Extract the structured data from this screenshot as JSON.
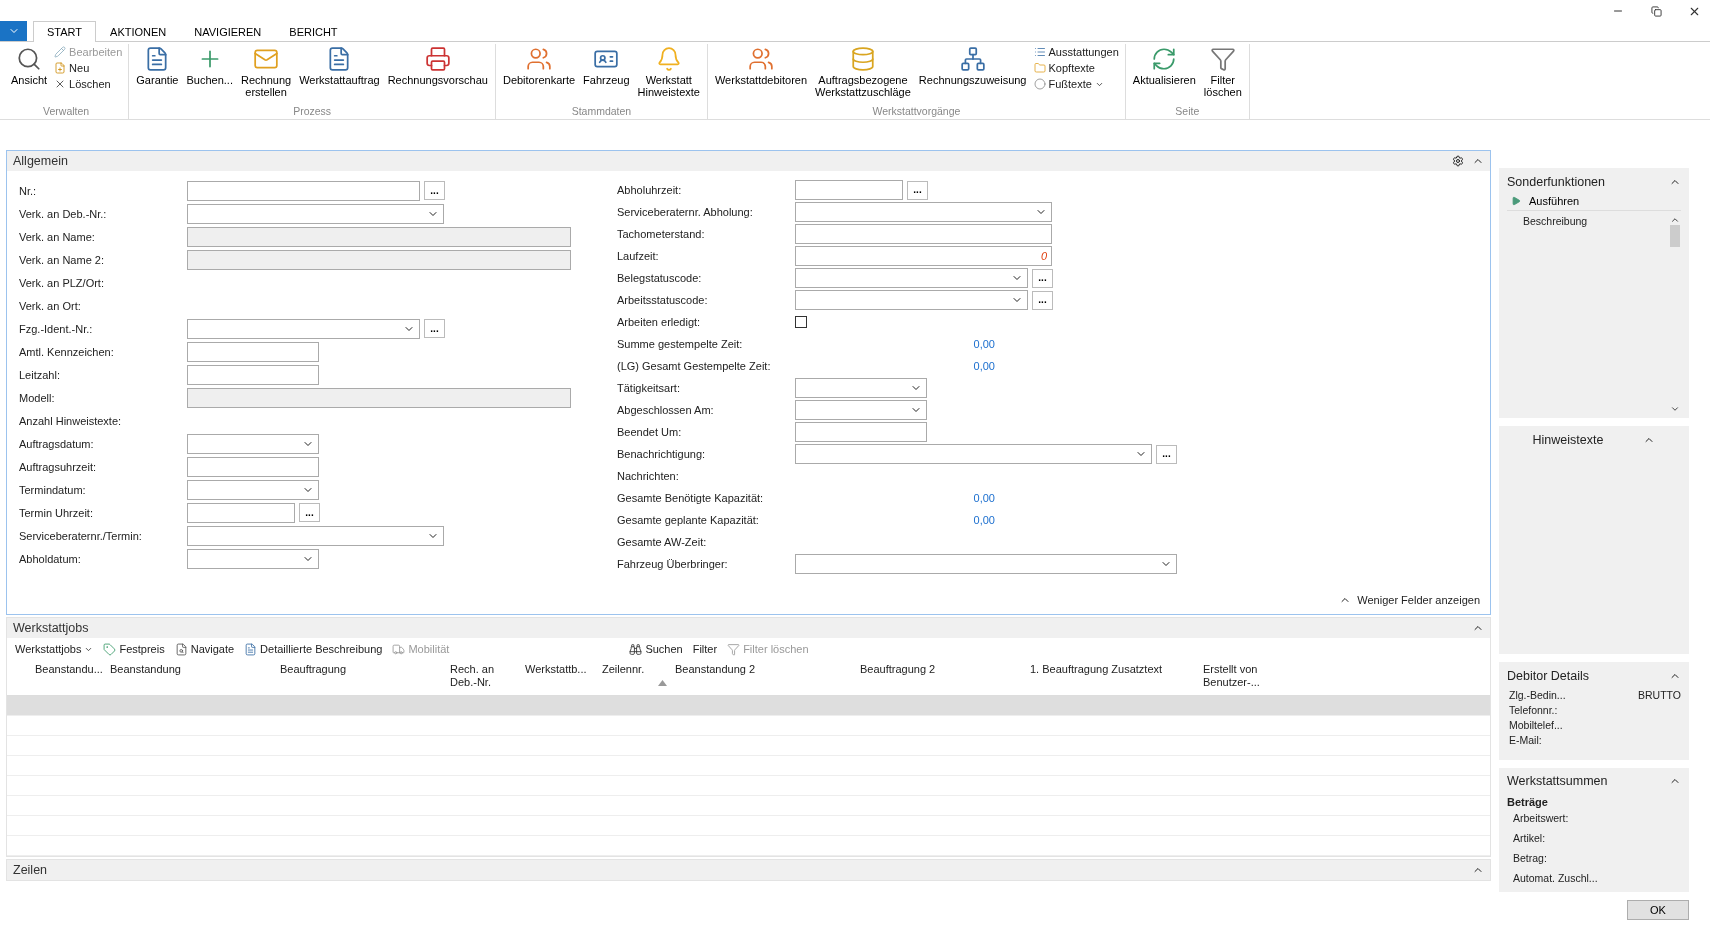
{
  "tabs": [
    {
      "label": "START",
      "selected": true
    },
    {
      "label": "AKTIONEN",
      "selected": false
    },
    {
      "label": "NAVIGIEREN",
      "selected": false
    },
    {
      "label": "BERICHT",
      "selected": false
    }
  ],
  "ribbon": [
    {
      "title": "Verwalten",
      "items": [
        {
          "kind": "large",
          "label": "Ansicht"
        },
        {
          "kind": "small-stack",
          "items": [
            {
              "label": "Bearbeiten",
              "disabled": true
            },
            {
              "label": "Neu",
              "disabled": false
            },
            {
              "label": "Löschen",
              "disabled": false
            }
          ]
        }
      ]
    },
    {
      "title": "Prozess",
      "items": [
        {
          "kind": "large",
          "label": "Garantie"
        },
        {
          "kind": "large",
          "label": "Buchen..."
        },
        {
          "kind": "large",
          "label": "Rechnung\nerstellen"
        },
        {
          "kind": "large",
          "label": "Werkstattauftrag"
        },
        {
          "kind": "large",
          "label": "Rechnungsvorschau"
        }
      ]
    },
    {
      "title": "Stammdaten",
      "items": [
        {
          "kind": "large",
          "label": "Debitorenkarte"
        },
        {
          "kind": "large",
          "label": "Fahrzeug"
        },
        {
          "kind": "large",
          "label": "Werkstatt\nHinweistexte"
        }
      ]
    },
    {
      "title": "Werkstattvorgänge",
      "items": [
        {
          "kind": "large",
          "label": "Werkstattdebitoren"
        },
        {
          "kind": "large",
          "label": "Auftragsbezogene\nWerkstattzuschläge"
        },
        {
          "kind": "large",
          "label": "Rechnungszuweisung"
        },
        {
          "kind": "small-stack",
          "items": [
            {
              "label": "Ausstattungen",
              "disabled": false
            },
            {
              "label": "Kopftexte",
              "disabled": false
            },
            {
              "label": "Fußtexte",
              "disabled": false,
              "caret": true
            }
          ]
        }
      ]
    },
    {
      "title": "Seite",
      "items": [
        {
          "kind": "large",
          "label": "Aktualisieren"
        },
        {
          "kind": "large",
          "label": "Filter\nlöschen"
        }
      ]
    }
  ],
  "general": {
    "title": "Allgemein",
    "expanded": true,
    "more_link": "Weniger Felder anzeigen",
    "left": [
      {
        "label": "Nr.:",
        "kind": "text",
        "lookup_button": "..."
      },
      {
        "label": "Verk. an Deb.-Nr.:",
        "kind": "dropdown"
      },
      {
        "label": "Verk. an Name:",
        "kind": "readonly"
      },
      {
        "label": "Verk. an Name 2:",
        "kind": "readonly"
      },
      {
        "label": "Verk. an PLZ/Ort:",
        "kind": "none"
      },
      {
        "label": "Verk. an Ort:",
        "kind": "none"
      },
      {
        "label": "Fzg.-Ident.-Nr.:",
        "kind": "dropdown",
        "lookup_button": "..."
      },
      {
        "label": "Amtl. Kennzeichen:",
        "kind": "text"
      },
      {
        "label": "Leitzahl:",
        "kind": "text"
      },
      {
        "label": "Modell:",
        "kind": "readonly"
      },
      {
        "label": "Anzahl Hinweistexte:",
        "kind": "none"
      },
      {
        "label": "Auftragsdatum:",
        "kind": "dropdown"
      },
      {
        "label": "Auftragsuhrzeit:",
        "kind": "text"
      },
      {
        "label": "Termindatum:",
        "kind": "dropdown"
      },
      {
        "label": "Termin Uhrzeit:",
        "kind": "text",
        "lookup_button": "..."
      },
      {
        "label": "Serviceberaternr./Termin:",
        "kind": "dropdown"
      },
      {
        "label": "Abholdatum:",
        "kind": "dropdown"
      }
    ],
    "right": [
      {
        "label": "Abholuhrzeit:",
        "kind": "text",
        "lookup_button": "..."
      },
      {
        "label": "Serviceberaternr. Abholung:",
        "kind": "dropdown"
      },
      {
        "label": "Tachometerstand:",
        "kind": "text"
      },
      {
        "label": "Laufzeit:",
        "kind": "text",
        "value": "0"
      },
      {
        "label": "Belegstatuscode:",
        "kind": "dropdown",
        "lookup_button": "..."
      },
      {
        "label": "Arbeitsstatuscode:",
        "kind": "dropdown",
        "lookup_button": "..."
      },
      {
        "label": "Arbeiten erledigt:",
        "kind": "checkbox",
        "checked": false
      },
      {
        "label": "Summe gestempelte Zeit:",
        "kind": "value",
        "value": "0,00"
      },
      {
        "label": "(LG) Gesamt Gestempelte Zeit:",
        "kind": "value",
        "value": "0,00"
      },
      {
        "label": "Tätigkeitsart:",
        "kind": "dropdown"
      },
      {
        "label": "Abgeschlossen Am:",
        "kind": "dropdown"
      },
      {
        "label": "Beendet Um:",
        "kind": "text"
      },
      {
        "label": "Benachrichtigung:",
        "kind": "dropdown",
        "lookup_button": "..."
      },
      {
        "label": "Nachrichten:",
        "kind": "none"
      },
      {
        "label": "Gesamte Benötigte Kapazität:",
        "kind": "value",
        "value": "0,00"
      },
      {
        "label": "Gesamte geplante Kapazität:",
        "kind": "value",
        "value": "0,00"
      },
      {
        "label": "Gesamte AW-Zeit:",
        "kind": "none"
      },
      {
        "label": "Fahrzeug Überbringer:",
        "kind": "dropdown"
      }
    ]
  },
  "jobs": {
    "title": "Werkstattjobs",
    "toolbar": [
      {
        "kind": "menu",
        "label": "Werkstattjobs",
        "disabled": false
      },
      {
        "kind": "action",
        "label": "Festpreis",
        "disabled": false
      },
      {
        "kind": "action",
        "label": "Navigate",
        "disabled": false
      },
      {
        "kind": "action",
        "label": "Detaillierte Beschreibung",
        "disabled": false
      },
      {
        "kind": "action",
        "label": "Mobilität",
        "disabled": true
      },
      {
        "kind": "spacer"
      },
      {
        "kind": "action",
        "label": "Suchen",
        "disabled": false
      },
      {
        "kind": "action",
        "label": "Filter",
        "disabled": false
      },
      {
        "kind": "action",
        "label": "Filter löschen",
        "disabled": true
      }
    ],
    "columns": [
      {
        "label": "Beanstandu...",
        "sorted": false
      },
      {
        "label": "Beanstandung",
        "sorted": false
      },
      {
        "label": "Beauftragung",
        "sorted": false
      },
      {
        "label": "Rech. an Deb.-Nr.",
        "sorted": false
      },
      {
        "label": "Werkstattb...",
        "sorted": false
      },
      {
        "label": "Zeilennr.",
        "sorted": true
      },
      {
        "label": "Beanstandung 2",
        "sorted": false
      },
      {
        "label": "Beauftragung 2",
        "sorted": false
      },
      {
        "label": "1. Beauftragung Zusatztext",
        "sorted": false
      },
      {
        "label": "Erstellt von Benutzer-...",
        "sorted": false
      }
    ],
    "rows": [
      {
        "selected": true
      },
      {
        "selected": false
      },
      {
        "selected": false
      },
      {
        "selected": false
      },
      {
        "selected": false
      },
      {
        "selected": false
      },
      {
        "selected": false
      },
      {
        "selected": false
      }
    ]
  },
  "lines": {
    "title": "Zeilen"
  },
  "factbox": {
    "special": {
      "title": "Sonderfunktionen",
      "action": "Ausführen",
      "column": "Beschreibung"
    },
    "notes": {
      "title": "Hinweistexte"
    },
    "customer": {
      "title": "Debitor Details",
      "fields": [
        {
          "label": "Zlg.-Bedin...",
          "value": "BRUTTO"
        },
        {
          "label": "Telefonnr.:"
        },
        {
          "label": "Mobiltelef..."
        },
        {
          "label": "E-Mail:"
        }
      ]
    },
    "totals": {
      "title": "Werkstattsummen",
      "group": "Beträge",
      "fields": [
        {
          "label": "Arbeitswert:"
        },
        {
          "label": "Artikel:"
        },
        {
          "label": "Betrag:"
        },
        {
          "label": "Automat. Zuschl..."
        }
      ]
    }
  },
  "ok_button": "OK"
}
